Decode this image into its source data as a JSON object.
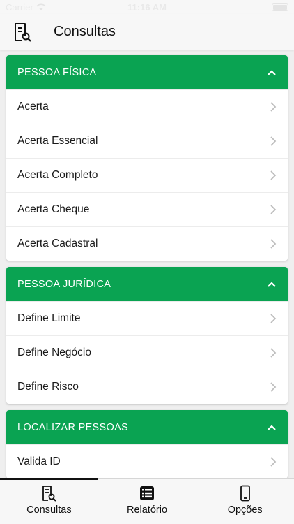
{
  "status_bar": {
    "carrier": "Carrier",
    "time": "11:16 AM"
  },
  "header": {
    "title": "Consultas",
    "icon": "document-search-icon"
  },
  "sections": [
    {
      "title": "PESSOA FÍSICA",
      "items": [
        "Acerta",
        "Acerta Essencial",
        "Acerta Completo",
        "Acerta Cheque",
        "Acerta Cadastral"
      ]
    },
    {
      "title": "PESSOA JURÍDICA",
      "items": [
        "Define Limite",
        "Define Negócio",
        "Define Risco"
      ]
    },
    {
      "title": "LOCALIZAR PESSOAS",
      "items": [
        "Valida ID"
      ]
    }
  ],
  "tabs": [
    {
      "label": "Consultas",
      "icon": "document-search-icon",
      "active": true
    },
    {
      "label": "Relatório",
      "icon": "list-icon",
      "active": false
    },
    {
      "label": "Opções",
      "icon": "phone-icon",
      "active": false
    }
  ],
  "colors": {
    "accent": "#0aa352",
    "background": "#efefef",
    "bar": "#f7f7f7"
  }
}
